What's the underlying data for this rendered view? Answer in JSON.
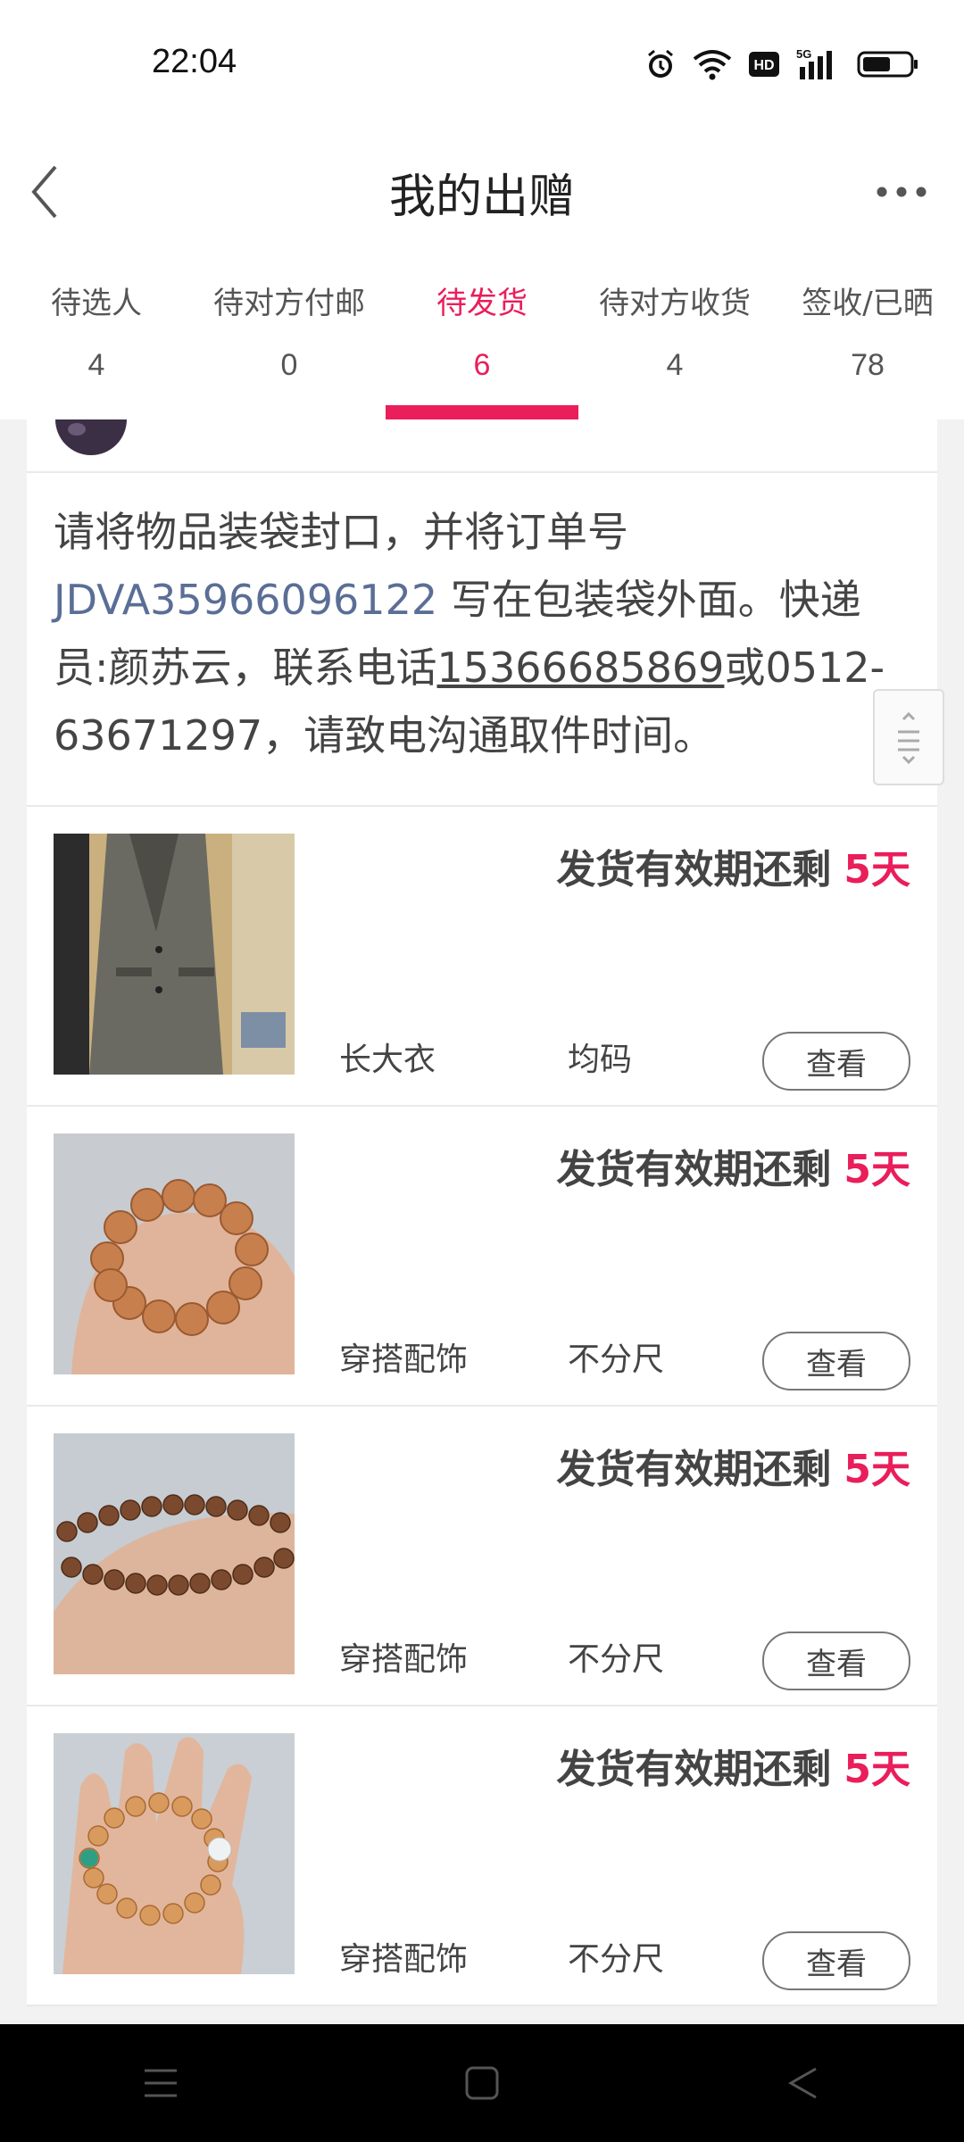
{
  "status_bar": {
    "time": "22:04",
    "icons": [
      "alarm-icon",
      "wifi-icon",
      "hd-icon",
      "5g-signal-icon",
      "battery-icon"
    ],
    "hd_text": "HD",
    "network_text": "5G"
  },
  "header": {
    "title": "我的出赠",
    "back_icon": "chevron-left-icon",
    "more_icon": "more-dots-icon"
  },
  "tabs": [
    {
      "label": "待选人",
      "count": "4"
    },
    {
      "label": "待对方付邮",
      "count": "0"
    },
    {
      "label": "待发货",
      "count": "6",
      "active": true
    },
    {
      "label": "待对方收货",
      "count": "4"
    },
    {
      "label": "签收/已晒",
      "count": "78"
    }
  ],
  "notice": {
    "text_1": "请将物品装袋封口，并将订单号 ",
    "order_no": "JDVA35966096122",
    "text_2": " 写在包装袋外面。快递员:颜苏云，联系电话",
    "phone": "15366685869",
    "text_3": "或0512-63671297，请致电沟通取件时间。"
  },
  "items": [
    {
      "deadline_label": "发货有效期还剩",
      "days": "5天",
      "category": "长大衣",
      "size": "均码",
      "button": "查看",
      "thumb": "coat-photo"
    },
    {
      "deadline_label": "发货有效期还剩",
      "days": "5天",
      "category": "穿搭配饰",
      "size": "不分尺",
      "button": "查看",
      "thumb": "bracelet-photo"
    },
    {
      "deadline_label": "发货有效期还剩",
      "days": "5天",
      "category": "穿搭配饰",
      "size": "不分尺",
      "button": "查看",
      "thumb": "beads-photo"
    },
    {
      "deadline_label": "发货有效期还剩",
      "days": "5天",
      "category": "穿搭配饰",
      "size": "不分尺",
      "button": "查看",
      "thumb": "bracelet-hand-photo"
    }
  ],
  "colors": {
    "accent": "#e91e5a",
    "link": "#5a6e96",
    "background": "#f2f2f2"
  },
  "nav_bar": [
    "menu-icon",
    "home-square-icon",
    "back-triangle-icon"
  ]
}
